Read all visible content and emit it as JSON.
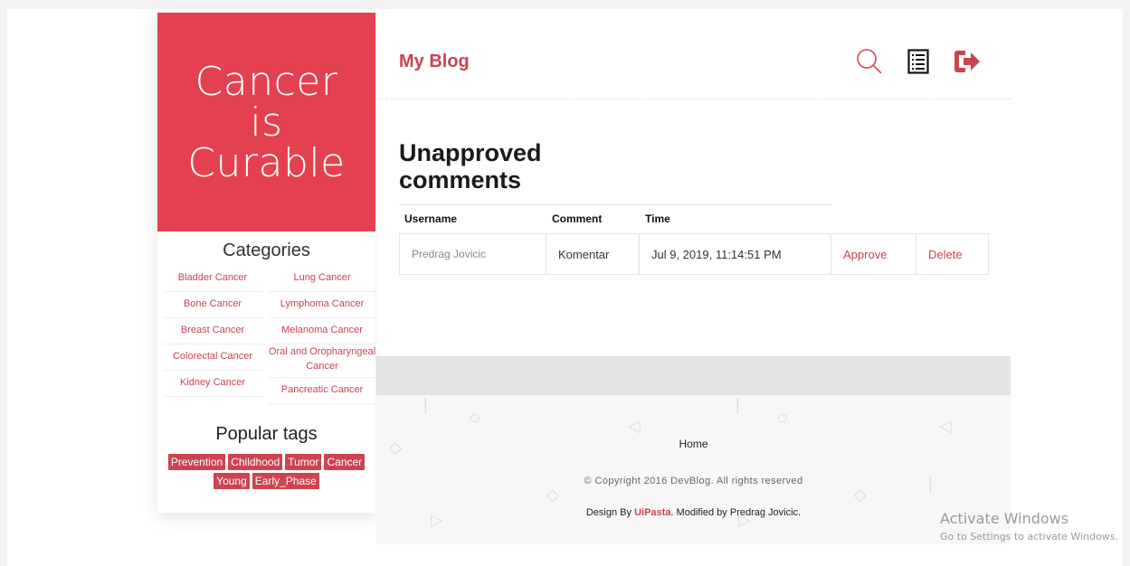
{
  "sidebar": {
    "logo_lines": [
      "Cancer",
      "is",
      "Curable"
    ],
    "categories_heading": "Categories",
    "categories_left": [
      "Bladder Cancer",
      "Bone Cancer",
      "Breast Cancer",
      "Colorectal Cancer",
      "Kidney Cancer"
    ],
    "categories_right": [
      "Lung Cancer",
      "Lymphoma Cancer",
      "Melanoma Cancer",
      "Oral and Oropharyngeal Cancer",
      "Pancreatic Cancer"
    ],
    "tags_heading": "Popular tags",
    "tags": [
      "Prevention",
      "Childhood",
      "Tumor",
      "Cancer",
      "Young",
      "Early_Phase"
    ]
  },
  "header": {
    "title": "My Blog",
    "icons": [
      "search-icon",
      "list-icon",
      "logout-icon"
    ]
  },
  "main": {
    "section_title": "Unapproved comments",
    "table": {
      "headers": [
        "Username",
        "Comment",
        "Time"
      ],
      "rows": [
        {
          "username": "Predrag Jovicic",
          "comment": "Komentar",
          "time": "Jul 9, 2019, 11:14:51 PM",
          "approve": "Approve",
          "delete": "Delete"
        }
      ]
    }
  },
  "footer": {
    "home": "Home",
    "copyright": "© Copyright 2016 DevBlog. All rights reserved",
    "design_prefix": "Design By ",
    "design_link": "UiPasta",
    "design_suffix": ". Modified by Predrag Jovicic."
  },
  "watermark": {
    "line1": "Activate Windows",
    "line2": "Go to Settings to activate Windows."
  },
  "colors": {
    "accent": "#e5404f",
    "link": "#c8434f"
  }
}
